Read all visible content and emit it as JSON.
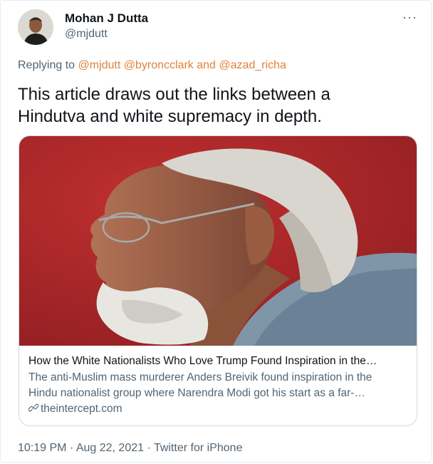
{
  "author": {
    "name": "Mohan J Dutta",
    "handle": "@mjdutt"
  },
  "more_label": "···",
  "reply": {
    "prefix": "Replying to ",
    "mentions": "@mjdutt @byroncclark",
    "joiner": " and ",
    "last_mention": "@azad_richa"
  },
  "tweet": {
    "line1": "This article draws out the links between a",
    "line2": "Hindutva and white supremacy in depth."
  },
  "link_card": {
    "title": "How the White Nationalists Who Love Trump Found Inspiration in the…",
    "desc_line1": "The anti-Muslim mass murderer Anders Breivik found inspiration in the",
    "desc_line2": "Hindu nationalist group where Narendra Modi got his start as a far-…",
    "domain": "theintercept.com",
    "domain_icon": "link-icon"
  },
  "footer": {
    "time": "10:19 PM",
    "sep1": " · ",
    "date": "Aug 22, 2021",
    "sep2": " · ",
    "source": "Twitter for iPhone"
  },
  "colors": {
    "mention": "#e0823c",
    "secondary_text": "#536471",
    "image_background": "#b0262a"
  }
}
